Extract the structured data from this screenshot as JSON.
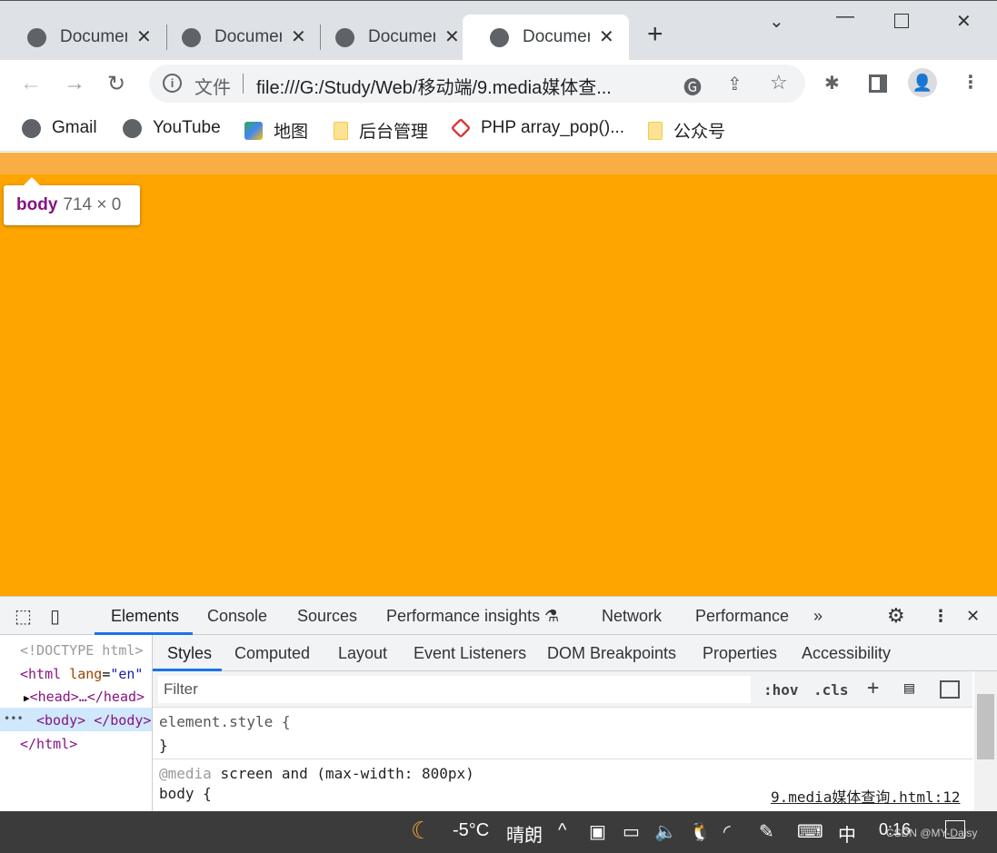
{
  "tabs": [
    {
      "label": "Document"
    },
    {
      "label": "Document"
    },
    {
      "label": "Document"
    },
    {
      "label": "Document",
      "active": true
    }
  ],
  "toolbar": {
    "security_label": "文件",
    "url": "file:///G:/Study/Web/移动端/9.media媒体查..."
  },
  "bookmarks": [
    {
      "label": "Gmail",
      "icon": "globe-icon"
    },
    {
      "label": "YouTube",
      "icon": "globe-icon"
    },
    {
      "label": "地图",
      "icon": "maps-icon"
    },
    {
      "label": "后台管理",
      "icon": "folder-icon"
    },
    {
      "label": "PHP array_pop()...",
      "icon": "php-icon"
    },
    {
      "label": "公众号",
      "icon": "folder-icon"
    }
  ],
  "page": {
    "background": "#ffa500",
    "tooltip_tag": "body",
    "tooltip_size": "714 × 0"
  },
  "devtools": {
    "tabs": [
      "Elements",
      "Console",
      "Sources",
      "Performance insights",
      "Network",
      "Performance"
    ],
    "dom": {
      "doctype": "<!DOCTYPE html>",
      "html_open": "<html",
      "lang_attr": "lang",
      "lang_val": "\"en\"",
      "head": "<head>…</head>",
      "body": "<body> </body>",
      "html_close": "</html>",
      "dots": "•••"
    },
    "style_tabs": [
      "Styles",
      "Computed",
      "Layout",
      "Event Listeners",
      "DOM Breakpoints",
      "Properties",
      "Accessibility"
    ],
    "filter_placeholder": "Filter",
    "hov": ":hov",
    "cls": ".cls",
    "rules": {
      "element_style": "element.style {",
      "close": "}",
      "media_kw": "@media",
      "media_query": "screen and (max-width: 800px)",
      "selector": "body {",
      "source": "9.media媒体查询.html:12"
    }
  },
  "taskbar": {
    "temp": "-5°C",
    "weather": "晴朗",
    "ime": "中",
    "time": "0:16",
    "watermark": "CSDN @MY-Daisy"
  }
}
